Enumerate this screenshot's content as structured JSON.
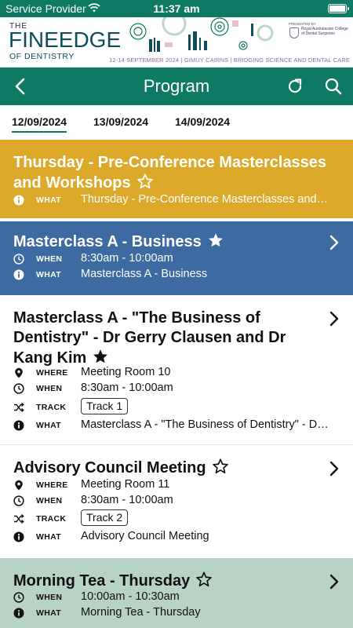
{
  "status_bar": {
    "carrier": "Service Provider",
    "time": "11:37 am"
  },
  "banner": {
    "the": "THE",
    "logo": "FINEEDGE",
    "logo_sub": "OF DENTISTRY",
    "tagline": "12-14 SEPTEMBER 2024 | GIMUY CAIRNS | BRIDGING SCIENCE AND DENTAL CARE",
    "presented_by": "PRESENTED BY",
    "college": "Royal Australasian College of Dental Surgeons"
  },
  "header": {
    "title": "Program"
  },
  "date_tabs": [
    {
      "label": "12/09/2024",
      "active": true
    },
    {
      "label": "13/09/2024",
      "active": false
    },
    {
      "label": "14/09/2024",
      "active": false
    }
  ],
  "colors": {
    "brand_green": "#0f7a63",
    "gold": "#dca92a",
    "blue": "#3d6aa0",
    "sage": "#b6d3c5"
  },
  "sessions": [
    {
      "title": "Thursday - Pre-Conference Masterclasses and Workshops",
      "starred": false,
      "rows": [
        {
          "label": "WHAT",
          "value": "Thursday - Pre-Conference Masterclasses and…"
        }
      ]
    },
    {
      "title": "Masterclass A - Business",
      "starred": true,
      "rows": [
        {
          "label": "WHEN",
          "value": "8:30am - 10:00am"
        },
        {
          "label": "WHAT",
          "value": "Masterclass A - Business"
        }
      ]
    },
    {
      "title": "Masterclass A - \"The Business of Dentistry\" - Dr Gerry Clausen and Dr Kang Kim",
      "starred": true,
      "rows": [
        {
          "label": "WHERE",
          "value": "Meeting Room 10"
        },
        {
          "label": "WHEN",
          "value": "8:30am - 10:00am"
        },
        {
          "label": "TRACK",
          "value": "Track 1"
        },
        {
          "label": "WHAT",
          "value": "Masterclass A - \"The Business of Dentistry\" - Dr…"
        }
      ]
    },
    {
      "title": "Advisory Council Meeting",
      "starred": false,
      "rows": [
        {
          "label": "WHERE",
          "value": "Meeting Room 11"
        },
        {
          "label": "WHEN",
          "value": "8:30am - 10:00am"
        },
        {
          "label": "TRACK",
          "value": "Track 2"
        },
        {
          "label": "WHAT",
          "value": "Advisory Council Meeting"
        }
      ]
    },
    {
      "title": "Morning Tea - Thursday",
      "starred": false,
      "rows": [
        {
          "label": "WHEN",
          "value": "10:00am - 10:30am"
        },
        {
          "label": "WHAT",
          "value": "Morning Tea - Thursday"
        }
      ]
    }
  ]
}
